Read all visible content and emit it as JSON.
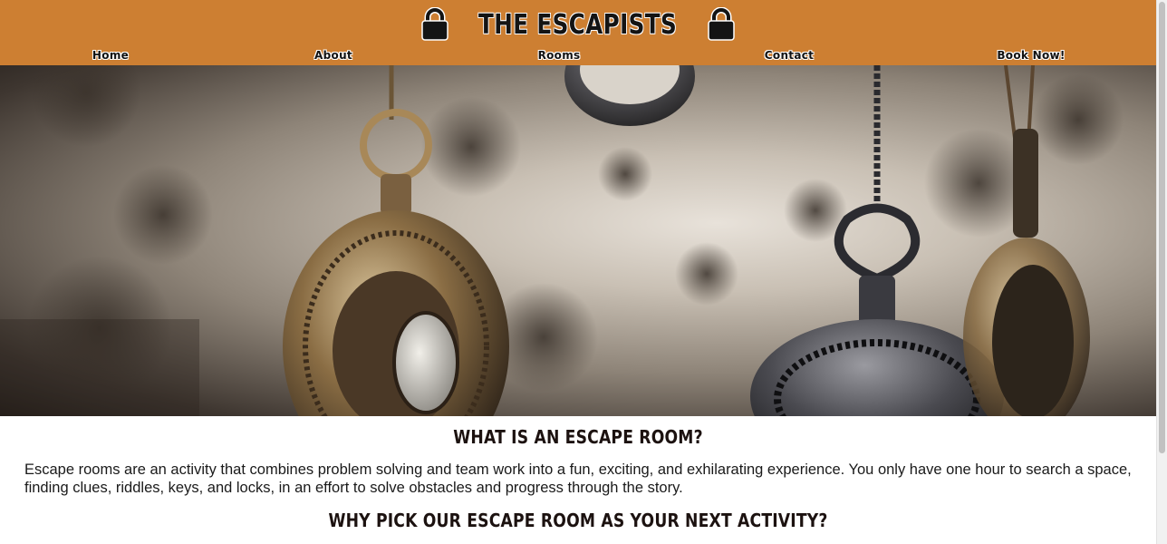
{
  "header": {
    "brand": "THE ESCAPISTS",
    "brand_icon": "lock-icon",
    "background_color": "#cd7f32"
  },
  "nav": {
    "items": [
      {
        "label": "Home"
      },
      {
        "label": "About"
      },
      {
        "label": "Rooms"
      },
      {
        "label": "Contact"
      },
      {
        "label": "Book Now!"
      }
    ]
  },
  "hero": {
    "image": "hanging pocket watches photo"
  },
  "main": {
    "heading_1": "WHAT IS AN ESCAPE ROOM?",
    "paragraph_1": "Escape rooms are an activity that combines problem solving and team work into a fun, exciting, and exhilarating experience. You only have one hour to search a space, finding clues, riddles, keys, and locks, in an effort to solve obstacles and progress through the story.",
    "heading_2": "WHY PICK OUR ESCAPE ROOM AS YOUR NEXT ACTIVITY?"
  }
}
